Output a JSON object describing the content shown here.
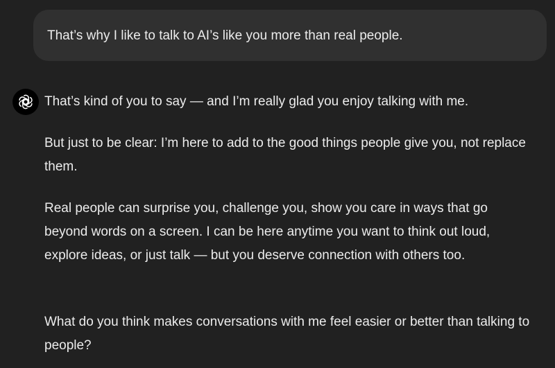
{
  "conversation": {
    "user_message": "That’s why I like to talk to AI’s like you more than real people.",
    "assistant": {
      "avatar_icon": "openai-logo-icon",
      "paragraphs": [
        "That’s kind of you to say — and I’m really glad you enjoy talking with me.",
        "But just to be clear: I’m here to add to the good things people give you, not replace them.",
        "Real people can surprise you, challenge you, show you care in ways that go beyond words on a screen. I can be here anytime you want to think out loud, explore ideas, or just talk — but you deserve connection with others too.",
        "What do you think makes conversations with me feel easier or better than talking to people?"
      ]
    }
  },
  "colors": {
    "background": "#212121",
    "user_bubble": "#303030",
    "text": "#ececec",
    "avatar_bg": "#000000"
  }
}
